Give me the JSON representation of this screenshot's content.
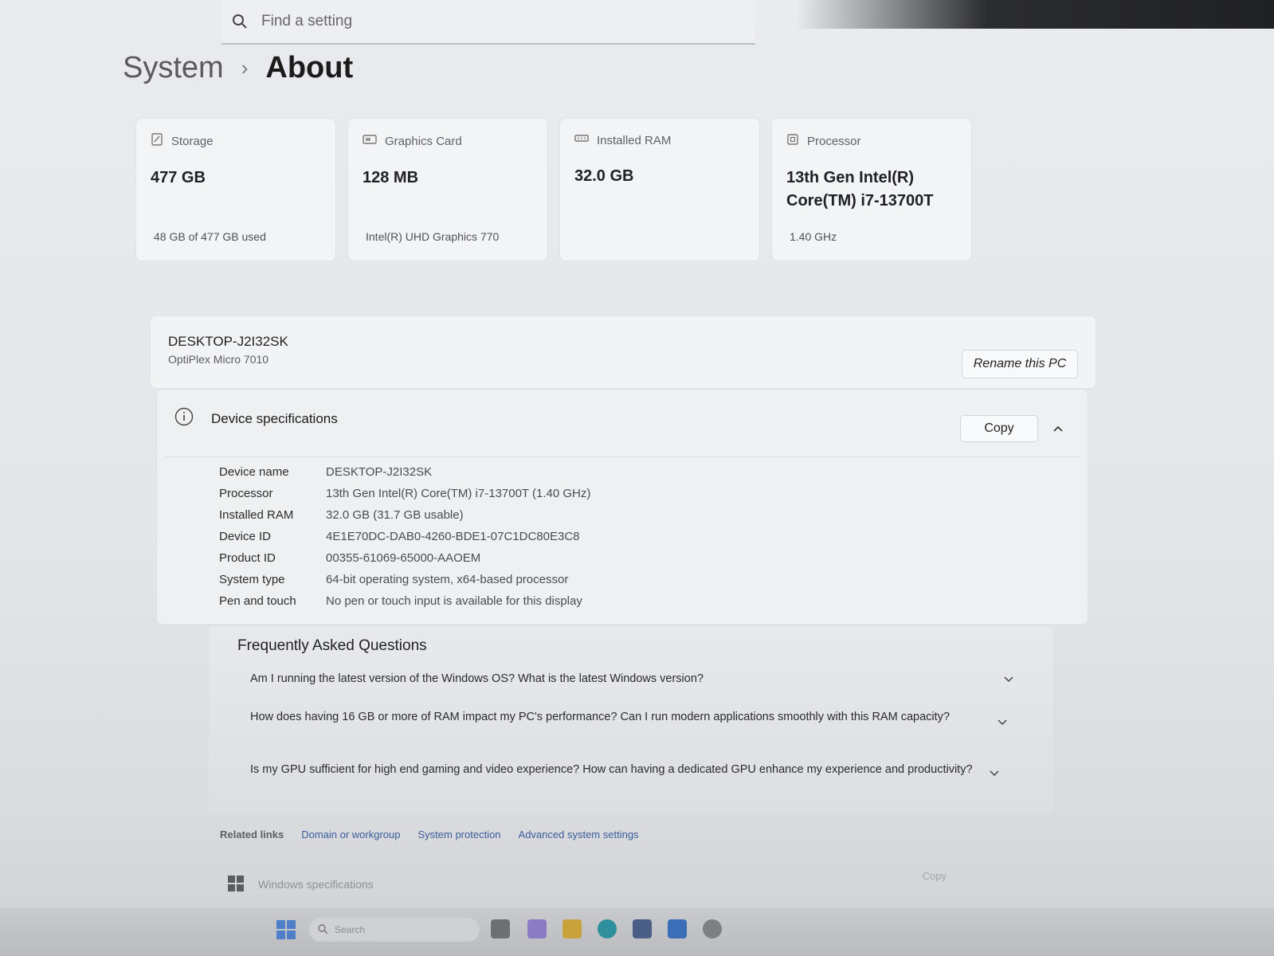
{
  "search": {
    "placeholder": "Find a setting"
  },
  "breadcrumb": {
    "parent": "System",
    "separator": "›",
    "current": "About"
  },
  "cards": [
    {
      "icon": "storage-icon",
      "label": "Storage",
      "value": "477 GB",
      "sub": "48 GB of 477 GB used"
    },
    {
      "icon": "graphics-card-icon",
      "label": "Graphics Card",
      "value": "128 MB",
      "sub": "Intel(R) UHD Graphics 770"
    },
    {
      "icon": "ram-icon",
      "label": "Installed RAM",
      "value": "32.0 GB",
      "sub": ""
    },
    {
      "icon": "processor-icon",
      "label": "Processor",
      "value": "13th Gen Intel(R) Core(TM) i7-13700T",
      "sub": "1.40 GHz"
    }
  ],
  "pc": {
    "name": "DESKTOP-J2I32SK",
    "model": "OptiPlex Micro 7010",
    "rename_label": "Rename this PC"
  },
  "device_specs": {
    "title": "Device specifications",
    "copy_label": "Copy",
    "rows": [
      {
        "key": "Device name",
        "value": "DESKTOP-J2I32SK"
      },
      {
        "key": "Processor",
        "value": "13th Gen Intel(R) Core(TM) i7-13700T (1.40 GHz)"
      },
      {
        "key": "Installed RAM",
        "value": "32.0 GB (31.7 GB usable)"
      },
      {
        "key": "Device ID",
        "value": "4E1E70DC-DAB0-4260-BDE1-07C1DC80E3C8"
      },
      {
        "key": "Product ID",
        "value": "00355-61069-65000-AAOEM"
      },
      {
        "key": "System type",
        "value": "64-bit operating system, x64-based processor"
      },
      {
        "key": "Pen and touch",
        "value": "No pen or touch input is available for this display"
      }
    ]
  },
  "faq": {
    "title": "Frequently Asked Questions",
    "questions": [
      "Am I running the latest version of the Windows OS? What is the latest Windows version?",
      "How does having 16 GB or more of RAM impact my PC's performance? Can I run modern applications smoothly with this RAM capacity?",
      "Is my GPU sufficient for high end gaming and video experience? How can having a dedicated GPU enhance my experience and productivity?"
    ]
  },
  "related": {
    "label": "Related links",
    "links": [
      "Domain or workgroup",
      "System protection",
      "Advanced system settings"
    ]
  },
  "windows_specs": {
    "title": "Windows specifications",
    "copy_label": "Copy"
  },
  "taskbar": {
    "search_placeholder": "Search"
  },
  "colors": {
    "accent": "#3b5e9a",
    "background": "#e6e8eb",
    "card": "#f3f4f6"
  }
}
